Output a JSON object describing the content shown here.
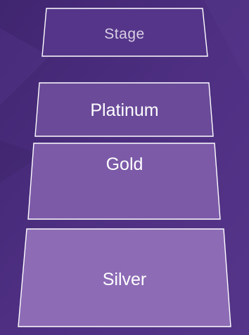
{
  "diagram": {
    "tiers": [
      {
        "key": "stage",
        "label": "Stage"
      },
      {
        "key": "platinum",
        "label": "Platinum"
      },
      {
        "key": "gold",
        "label": "Gold"
      },
      {
        "key": "silver",
        "label": "Silver"
      }
    ]
  },
  "colors": {
    "background": "#4b2d7d",
    "stage_fill": "#55358a",
    "platinum_fill": "#6a4a99",
    "gold_fill": "#7c5aa8",
    "silver_fill": "#8d6bb5",
    "outline": "#ffffff"
  }
}
